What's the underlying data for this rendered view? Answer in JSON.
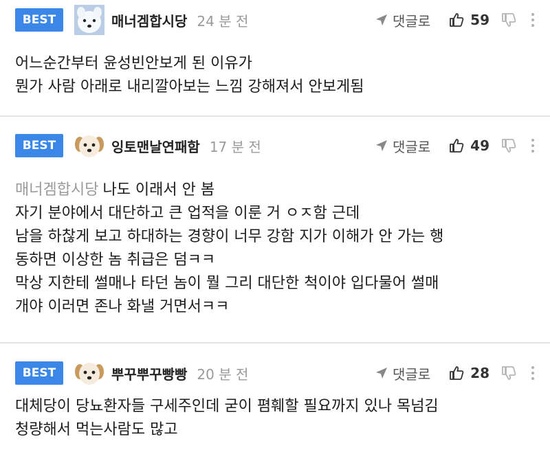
{
  "comments": [
    {
      "badge": "BEST",
      "avatar_icon": "white-dog-face-avatar",
      "nickname": "매너겜합시당",
      "time": "24 분 전",
      "reply_label": "댓글로",
      "likes": "59",
      "mention": "",
      "lines": [
        "어느순간부터 윤성빈안보게 된 이유가",
        "뭔가 사람 아래로 내리깔아보는 느낌 강해져서 안보게됨"
      ]
    },
    {
      "badge": "BEST",
      "avatar_icon": "puppy-face-avatar",
      "nickname": "잉토맨날연패함",
      "time": "17 분 전",
      "reply_label": "댓글로",
      "likes": "49",
      "mention": "매너겜합시당",
      "lines": [
        "나도 이래서 안 봄",
        "자기 분야에서 대단하고 큰 업적을 이룬 거 ㅇㅈ함 근데",
        "남을 하찮게 보고 하대하는 경향이 너무 강함 지가 이해가 안 가는 행",
        "동하면 이상한 놈 취급은 덤ㅋㅋ",
        "막상 지한테 썰매나 타던 놈이 뭘 그리 대단한 척이야 입다물어 썰매",
        "개야 이러면 존나 화낼 거면서ㅋㅋ"
      ]
    },
    {
      "badge": "BEST",
      "avatar_icon": "puppy-face-avatar",
      "nickname": "뿌꾸뿌꾸빵빵",
      "time": "20 분 전",
      "reply_label": "댓글로",
      "likes": "28",
      "mention": "",
      "lines": [
        "대체당이 당뇨환자들 구세주인데 굳이 폄훼할 필요까지 있나 목넘김",
        "청량해서 먹는사람도 많고"
      ]
    }
  ],
  "colors": {
    "badge": "#3a87e8",
    "muted": "#9a9a9a",
    "text": "#1c1c1c"
  }
}
